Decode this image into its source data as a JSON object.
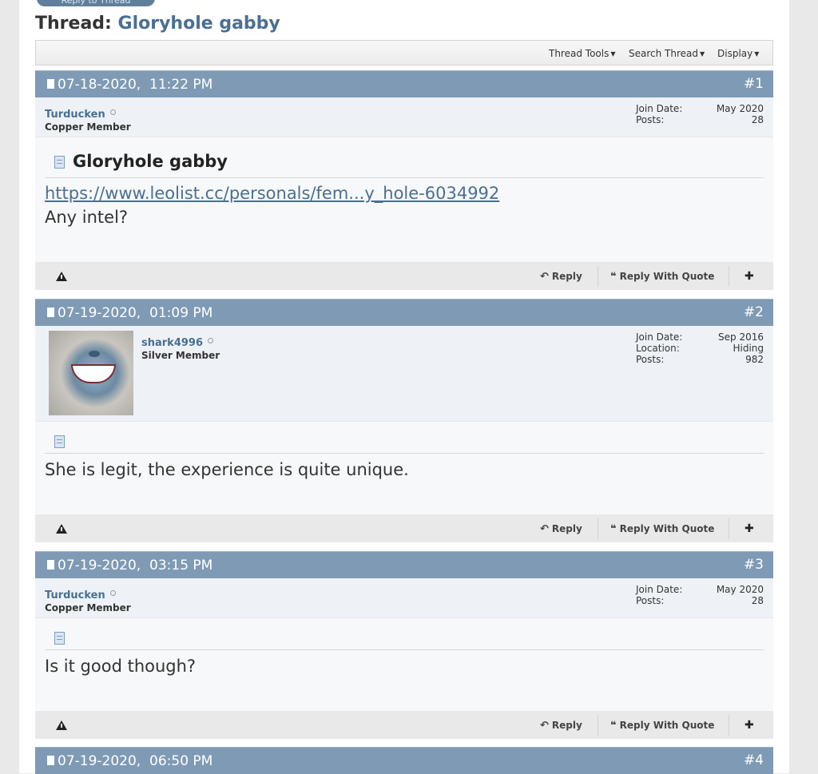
{
  "top_button": {
    "label": "Reply to Thread"
  },
  "thread": {
    "prefix": "Thread:",
    "name": "Gloryhole gabby"
  },
  "toolbar": {
    "thread_tools": "Thread Tools",
    "search_thread": "Search Thread",
    "display": "Display"
  },
  "stat_labels": {
    "join": "Join Date:",
    "location": "Location:",
    "posts": "Posts:"
  },
  "actions": {
    "reply": "Reply",
    "reply_quote": "Reply With Quote"
  },
  "posts": [
    {
      "date": "07-18-2020,",
      "time": "11:22 PM",
      "number": "#1",
      "user": {
        "name": "Turducken",
        "rank": "Copper Member",
        "join_date": "May 2020",
        "posts": "28"
      },
      "title": "Gloryhole gabby",
      "link": "https://www.leolist.cc/personals/fem...y_hole-6034992",
      "text": "Any intel?"
    },
    {
      "date": "07-19-2020,",
      "time": "01:09 PM",
      "number": "#2",
      "user": {
        "name": "shark4996",
        "rank": "Silver Member",
        "join_date": "Sep 2016",
        "location": "Hiding",
        "posts": "982"
      },
      "text": "She is legit, the experience is quite unique."
    },
    {
      "date": "07-19-2020,",
      "time": "03:15 PM",
      "number": "#3",
      "user": {
        "name": "Turducken",
        "rank": "Copper Member",
        "join_date": "May 2020",
        "posts": "28"
      },
      "text": "Is it good though?"
    },
    {
      "date": "07-19-2020,",
      "time": "06:50 PM",
      "number": "#4"
    }
  ]
}
